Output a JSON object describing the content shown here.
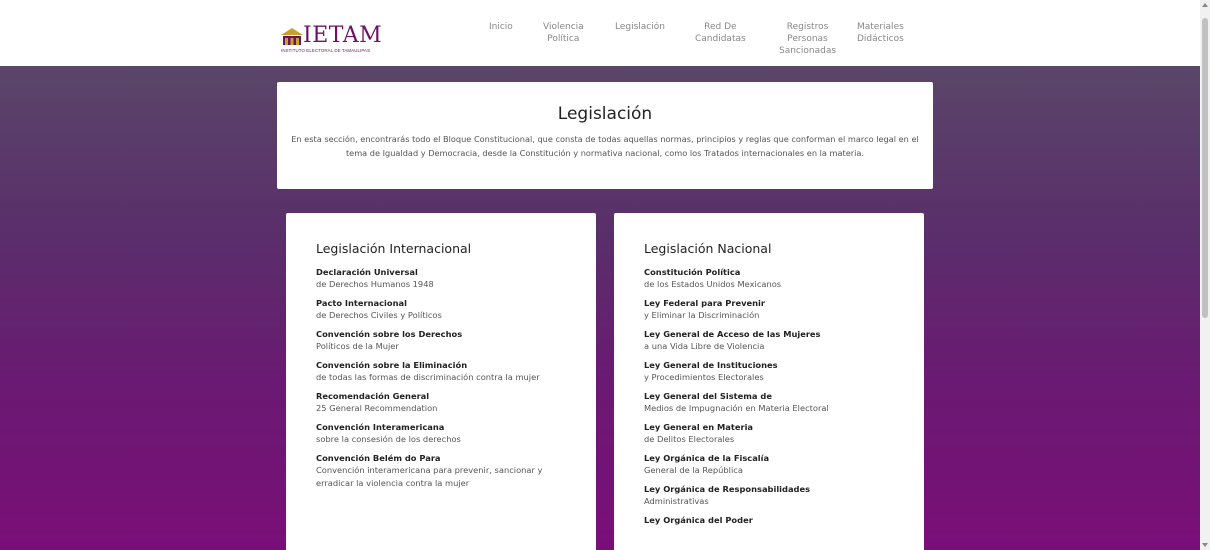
{
  "header": {
    "logo_text": "IETAM",
    "logo_subtitle": "INSTITUTO ELECTORAL DE TAMAULIPAS",
    "nav": [
      {
        "label": "Inicio"
      },
      {
        "label": "Violencia\nPolítica"
      },
      {
        "label": "Legislación"
      },
      {
        "label": "Red De\nCandidatas"
      },
      {
        "label": "Registros\nPersonas\nSancionadas"
      },
      {
        "label": "Materiales\nDidácticos"
      }
    ]
  },
  "intro": {
    "title": "Legislación",
    "text": "En esta sección, encontrarás todo el Bloque Constitucional, que consta de todas aquellas normas, principios y reglas que conforman el marco legal en el tema de Igualdad y Democracia, desde la Constitución y normativa nacional, como los Tratados internacionales en la materia."
  },
  "international": {
    "title": "Legislación Internacional",
    "items": [
      {
        "title": "Declaración Universal",
        "sub": "de Derechos Humanos 1948"
      },
      {
        "title": "Pacto Internacional",
        "sub": "de Derechos Civiles y Políticos"
      },
      {
        "title": "Convención sobre los Derechos",
        "sub": "Políticos de la Mujer"
      },
      {
        "title": "Convención sobre la Eliminación",
        "sub": "de todas las formas de discriminación contra la mujer"
      },
      {
        "title": "Recomendación General",
        "sub": "25 General Recommendation"
      },
      {
        "title": "Convención Interamericana",
        "sub": "sobre la consesión de los derechos"
      },
      {
        "title": "Convención Belém do Para",
        "sub": "Convención interamericana para prevenir, sancionar y erradicar la violencia contra la mujer"
      }
    ]
  },
  "national": {
    "title": "Legislación Nacional",
    "items": [
      {
        "title": "Constitución Política",
        "sub": "de los Estados Unidos Mexicanos"
      },
      {
        "title": "Ley Federal para Prevenir",
        "sub": "y Eliminar la Discriminación"
      },
      {
        "title": "Ley General de Acceso de las Mujeres",
        "sub": "a una Vida Libre de Violencia"
      },
      {
        "title": "Ley General de Instituciones",
        "sub": "y Procedimientos Electorales"
      },
      {
        "title": "Ley General del Sistema de",
        "sub": "Medios de Impugnación en Materia Electoral"
      },
      {
        "title": "Ley General en Materia",
        "sub": "de Delitos Electorales"
      },
      {
        "title": "Ley Orgánica de la Fiscalía",
        "sub": "General de la República"
      },
      {
        "title": "Ley Orgánica de Responsabilidades",
        "sub": "Administrativas"
      },
      {
        "title": "Ley Orgánica del Poder",
        "sub": ""
      }
    ]
  },
  "colors": {
    "brand": "#6b1363",
    "band_top": "#5a4668",
    "band_bottom": "#7a0e78"
  }
}
